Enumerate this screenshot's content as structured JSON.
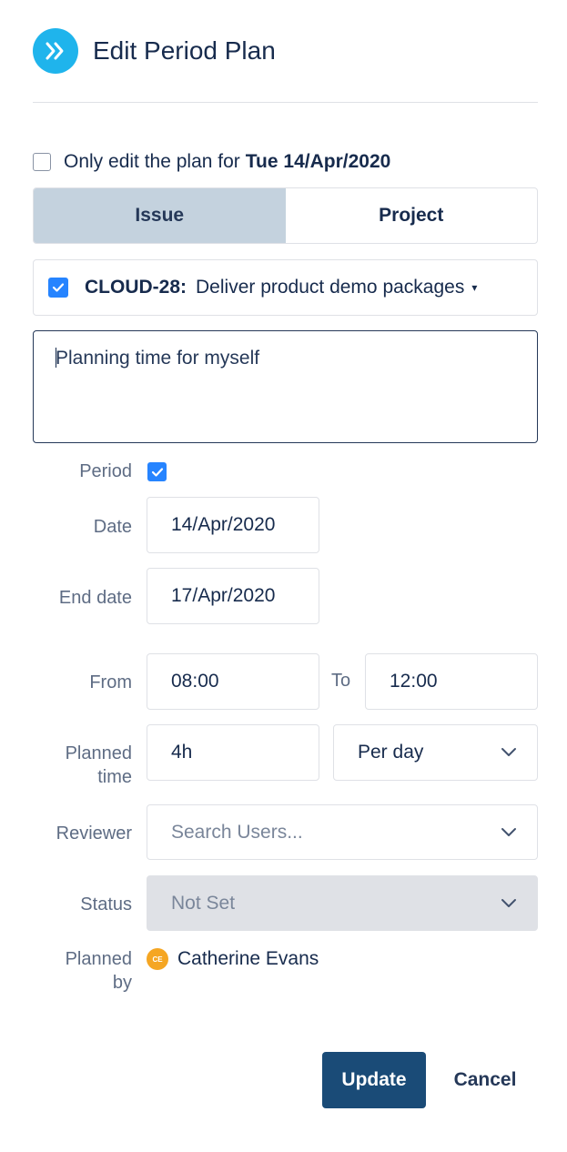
{
  "dialog": {
    "title": "Edit Period Plan",
    "logo_icon": "double-chevron-right-icon",
    "accent_color": "#1fb4ec"
  },
  "only_edit": {
    "label_prefix": "Only edit the plan for",
    "date": "Tue 14/Apr/2020",
    "checked": false
  },
  "tabs": [
    {
      "label": "Issue",
      "active": true
    },
    {
      "label": "Project",
      "active": false
    }
  ],
  "issue": {
    "checked": true,
    "key": "CLOUD-28:",
    "summary": "Deliver product demo packages",
    "caret": "▾"
  },
  "description": "Planning time for myself",
  "form": {
    "period": {
      "label": "Period",
      "checked": true
    },
    "date": {
      "label": "Date",
      "value": "14/Apr/2020"
    },
    "end_date": {
      "label": "End date",
      "value": "17/Apr/2020"
    },
    "from": {
      "label": "From",
      "value": "08:00"
    },
    "to": {
      "label": "To",
      "value": "12:00"
    },
    "planned_time": {
      "label_line1": "Planned",
      "label_line2": "time",
      "value": "4h",
      "unit": "Per day"
    },
    "reviewer": {
      "label": "Reviewer",
      "placeholder": "Search Users..."
    },
    "status": {
      "label": "Status",
      "value": "Not Set"
    },
    "planned_by": {
      "label_line1": "Planned",
      "label_line2": "by",
      "initials": "CE",
      "name": "Catherine Evans"
    }
  },
  "buttons": {
    "update": "Update",
    "cancel": "Cancel",
    "primary_color": "#1a4b77"
  }
}
